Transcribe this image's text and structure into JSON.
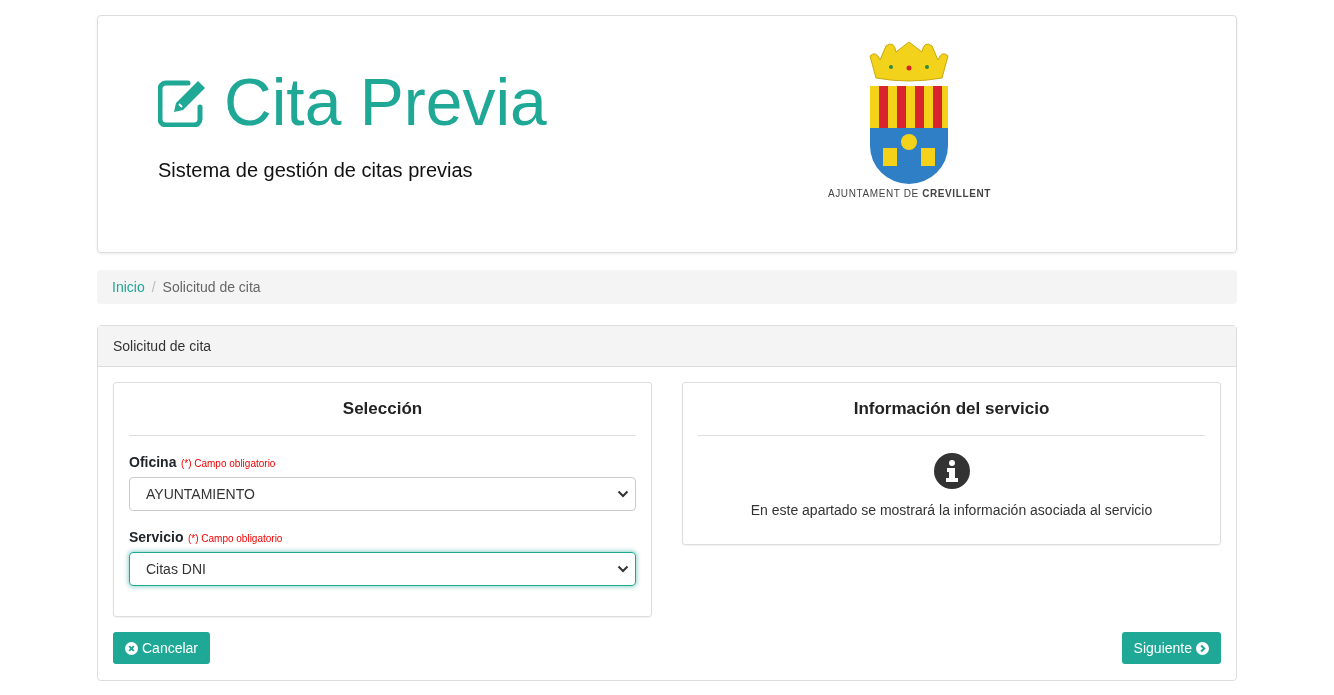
{
  "header": {
    "title": "Cita Previa",
    "subtitle": "Sistema de gestión de citas previas",
    "logo_caption": "AJUNTAMENT DE **CREVILLENT**"
  },
  "breadcrumb": [
    {
      "label": "Inicio",
      "kind": "link"
    },
    {
      "label": "/",
      "kind": "separator"
    },
    {
      "label": "Solicitud de cita",
      "kind": "current"
    }
  ],
  "panel": {
    "title": "Solicitud de cita",
    "selection": {
      "title": "Selección",
      "fields": [
        {
          "label": "Oficina",
          "required_note": "(*) Campo obligatorio",
          "value": "AYUNTAMIENTO",
          "focused": false
        },
        {
          "label": "Servicio",
          "required_note": "(*) Campo obligatorio",
          "value": "Citas DNI",
          "focused": true
        }
      ]
    },
    "info": {
      "title": "Información del servicio",
      "text": "En este apartado se mostrará la información asociada al servicio"
    },
    "buttons": [
      {
        "label": "Cancelar",
        "kind": "cancel"
      },
      {
        "label": "Siguiente",
        "kind": "next"
      }
    ]
  }
}
